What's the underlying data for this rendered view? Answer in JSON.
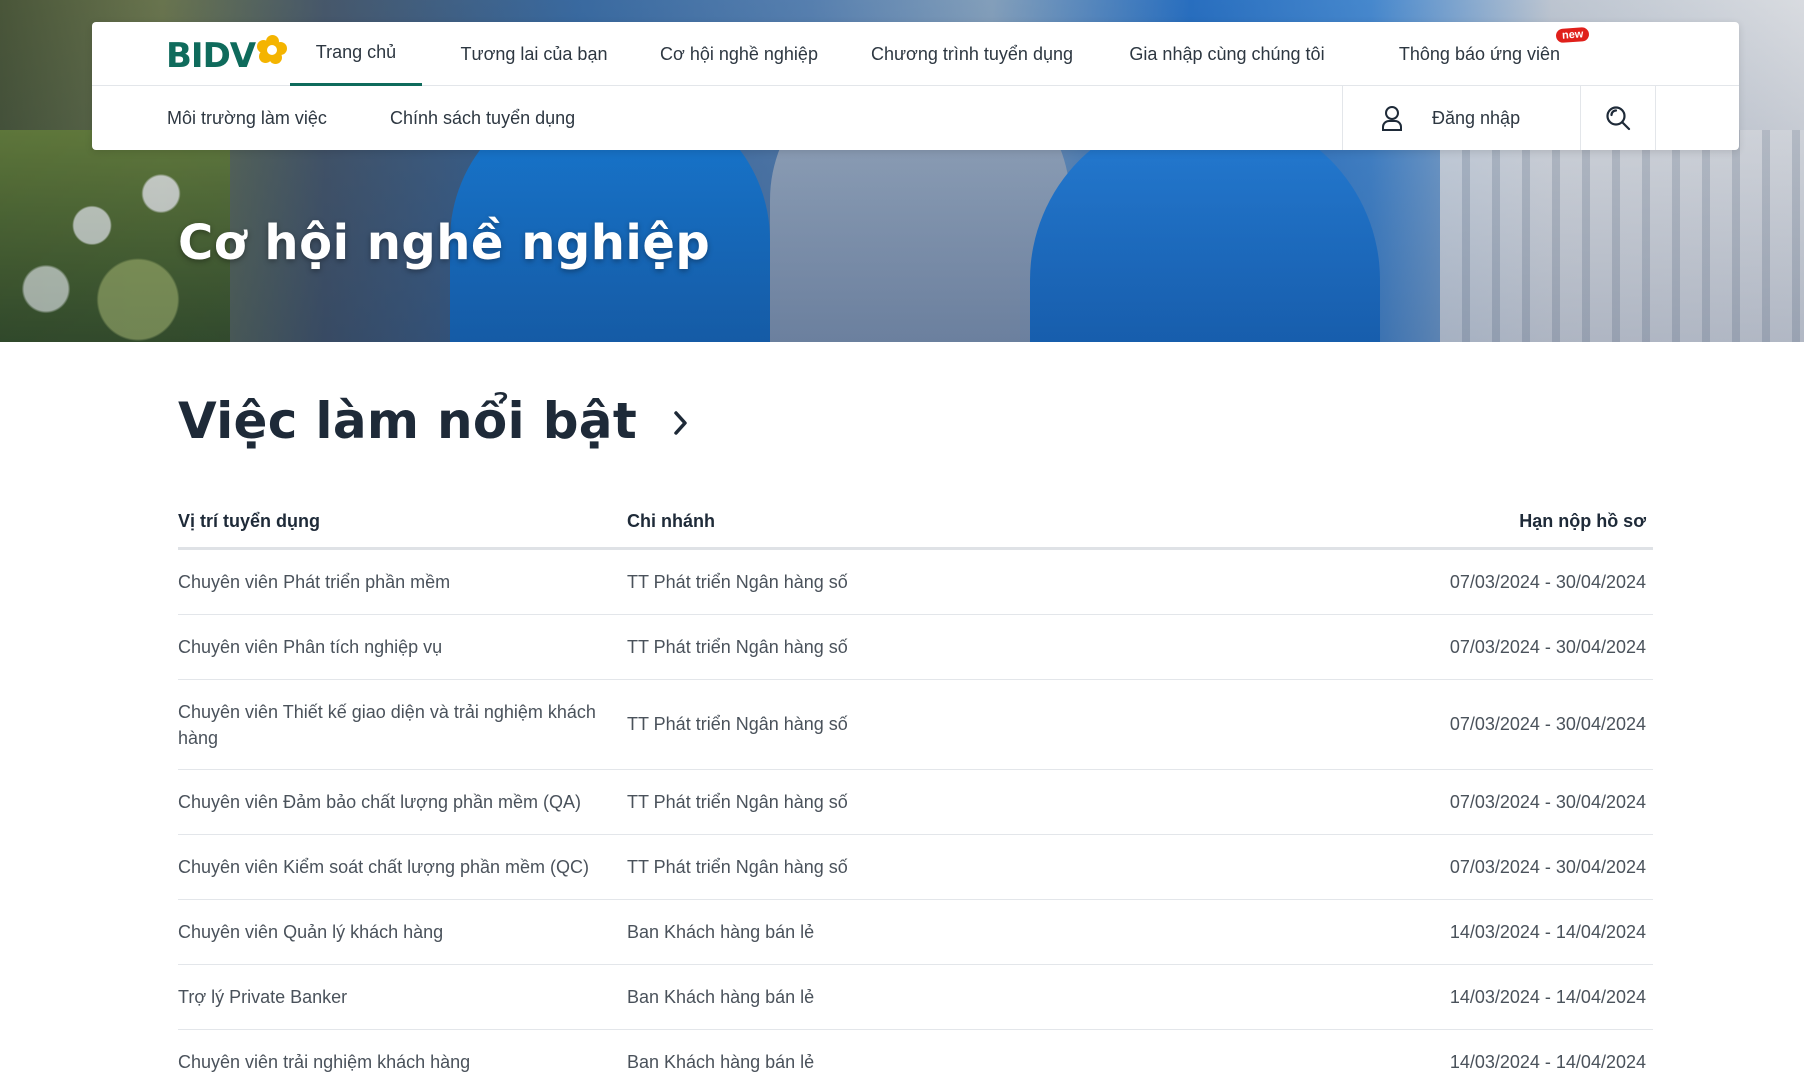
{
  "brand": {
    "logo_text": "BIDV",
    "accent": "#0f6b5c",
    "flower_color": "#f4b400"
  },
  "nav": {
    "primary": [
      {
        "label": "Trang chủ",
        "active": true
      },
      {
        "label": "Tương lai của bạn",
        "active": false
      },
      {
        "label": "Cơ hội nghề nghiệp",
        "active": false
      },
      {
        "label": "Chương trình tuyển dụng",
        "active": false
      },
      {
        "label": "Gia nhập cùng chúng tôi",
        "active": false
      },
      {
        "label": "Thông báo ứng viên",
        "active": false,
        "badge": "new"
      }
    ],
    "secondary": [
      {
        "label": "Môi trường làm việc"
      },
      {
        "label": "Chính sách tuyển dụng"
      }
    ],
    "login_label": "Đăng nhập",
    "user_icon": "user-icon",
    "search_icon": "search-icon"
  },
  "hero": {
    "title": "Cơ hội nghề nghiệp"
  },
  "jobs": {
    "title": "Việc làm nổi bật",
    "more_icon": "chevron-right-icon",
    "columns": [
      "Vị trí tuyển dụng",
      "Chi nhánh",
      "Hạn nộp hồ sơ"
    ],
    "rows": [
      {
        "position": "Chuyên viên Phát triển phần mềm",
        "branch": "TT Phát triển Ngân hàng số",
        "deadline": "07/03/2024 - 30/04/2024"
      },
      {
        "position": "Chuyên viên Phân tích nghiệp vụ",
        "branch": "TT Phát triển Ngân hàng số",
        "deadline": "07/03/2024 - 30/04/2024"
      },
      {
        "position": "Chuyên viên Thiết kế giao diện và trải nghiệm khách hàng",
        "branch": "TT Phát triển Ngân hàng số",
        "deadline": "07/03/2024 - 30/04/2024"
      },
      {
        "position": "Chuyên viên Đảm bảo chất lượng phần mềm (QA)",
        "branch": "TT Phát triển Ngân hàng số",
        "deadline": "07/03/2024 - 30/04/2024"
      },
      {
        "position": "Chuyên viên Kiểm soát chất lượng phần mềm (QC)",
        "branch": "TT Phát triển Ngân hàng số",
        "deadline": "07/03/2024 - 30/04/2024"
      },
      {
        "position": "Chuyên viên Quản lý khách hàng",
        "branch": "Ban Khách hàng bán lẻ",
        "deadline": "14/03/2024 - 14/04/2024"
      },
      {
        "position": "Trợ lý Private Banker",
        "branch": "Ban Khách hàng bán lẻ",
        "deadline": "14/03/2024 - 14/04/2024"
      },
      {
        "position": "Chuyên viên trải nghiệm khách hàng",
        "branch": "Ban Khách hàng bán lẻ",
        "deadline": "14/03/2024 - 14/04/2024"
      }
    ]
  }
}
